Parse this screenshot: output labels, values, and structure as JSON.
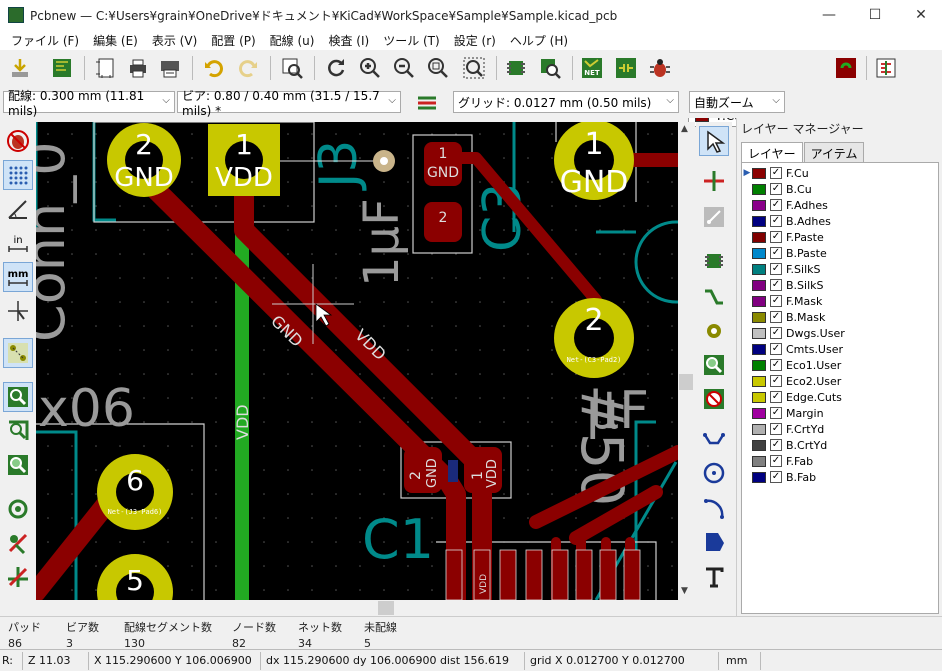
{
  "window": {
    "title": "Pcbnew — C:¥Users¥grain¥OneDrive¥ドキュメント¥KiCad¥WorkSpace¥Sample¥Sample.kicad_pcb",
    "minimize": "—",
    "maximize": "☐",
    "close": "✕"
  },
  "menu": {
    "items": [
      "ファイル (F)",
      "編集 (E)",
      "表示 (V)",
      "配置 (P)",
      "配線 (u)",
      "検査 (I)",
      "ツール (T)",
      "設定 (r)",
      "ヘルプ (H)"
    ]
  },
  "toolbar": {
    "layer_select": "F.Cu (PgUp)",
    "track_width": "配線: 0.300 mm (11.81 mils)",
    "via_size": "ビア: 0.80 / 0.40 mm (31.5 / 15.7 mils) *",
    "grid": "グリッド: 0.0127 mm (0.50 mils)",
    "zoom": "自動ズーム"
  },
  "colors": {
    "copper_front": "#8b0000",
    "pad": "#c8c800",
    "silk": "#009090",
    "edge_green": "#22aa22",
    "layer_fcu": "#8b0000"
  },
  "canvas": {
    "pads": [
      {
        "num": "2",
        "net": "GND"
      },
      {
        "num": "1",
        "net": "VDD"
      },
      {
        "num": "1",
        "net": "GND"
      },
      {
        "num": "2",
        "net": "GND"
      },
      {
        "num": "6",
        "net": ""
      },
      {
        "num": "5",
        "net": ""
      }
    ],
    "labels": {
      "conn": "Conn_0",
      "x06": "x06",
      "j3": "J3",
      "cap": "1µF",
      "c3": "C3",
      "c1": "C1",
      "track_gnd": "GND",
      "track_vdd": "VDD",
      "vdd_vert": "VDD",
      "uf": "µF",
      "hash50": "#50",
      "smd1_net": "GND",
      "smd1_num": "1",
      "smd2_num": "2",
      "c1_left_num": "2",
      "c1_left_net": "GND",
      "c1_right_num": "1",
      "c1_right_net": "VDD",
      "pad2_netlabel": "Net-(C3-Pad2)",
      "pad6_netlabel": "Net-(J3-Pad6)",
      "ic_pin": "VDD"
    }
  },
  "layer_manager": {
    "title": "レイヤー マネージャー",
    "tabs": [
      "レイヤー",
      "アイテム"
    ],
    "layers": [
      {
        "name": "F.Cu",
        "color": "#8b0000"
      },
      {
        "name": "B.Cu",
        "color": "#008000"
      },
      {
        "name": "F.Adhes",
        "color": "#8a008a"
      },
      {
        "name": "B.Adhes",
        "color": "#000080"
      },
      {
        "name": "F.Paste",
        "color": "#800000"
      },
      {
        "name": "B.Paste",
        "color": "#0088cc"
      },
      {
        "name": "F.SilkS",
        "color": "#008080"
      },
      {
        "name": "B.SilkS",
        "color": "#800080"
      },
      {
        "name": "F.Mask",
        "color": "#800080"
      },
      {
        "name": "B.Mask",
        "color": "#8a8a00"
      },
      {
        "name": "Dwgs.User",
        "color": "#c0c0c0"
      },
      {
        "name": "Cmts.User",
        "color": "#000080"
      },
      {
        "name": "Eco1.User",
        "color": "#008000"
      },
      {
        "name": "Eco2.User",
        "color": "#c8c800"
      },
      {
        "name": "Edge.Cuts",
        "color": "#c8c800"
      },
      {
        "name": "Margin",
        "color": "#a000a0"
      },
      {
        "name": "F.CrtYd",
        "color": "#b0b0b0"
      },
      {
        "name": "B.CrtYd",
        "color": "#404040"
      },
      {
        "name": "F.Fab",
        "color": "#808080"
      },
      {
        "name": "B.Fab",
        "color": "#000080"
      }
    ]
  },
  "info": {
    "pads_label": "パッド",
    "pads": "86",
    "vias_label": "ビア数",
    "vias": "3",
    "segments_label": "配線セグメント数",
    "segments": "130",
    "nodes_label": "ノード数",
    "nodes": "82",
    "nets_label": "ネット数",
    "nets": "34",
    "unrouted_label": "未配線",
    "unrouted": "5"
  },
  "status": {
    "r": "R:",
    "zoom": "Z 11.03",
    "xy": "X 115.290600  Y 106.006900",
    "dxdy": "dx 115.290600  dy 106.006900  dist 156.619",
    "grid": "grid X 0.012700  Y 0.012700",
    "units": "mm"
  }
}
